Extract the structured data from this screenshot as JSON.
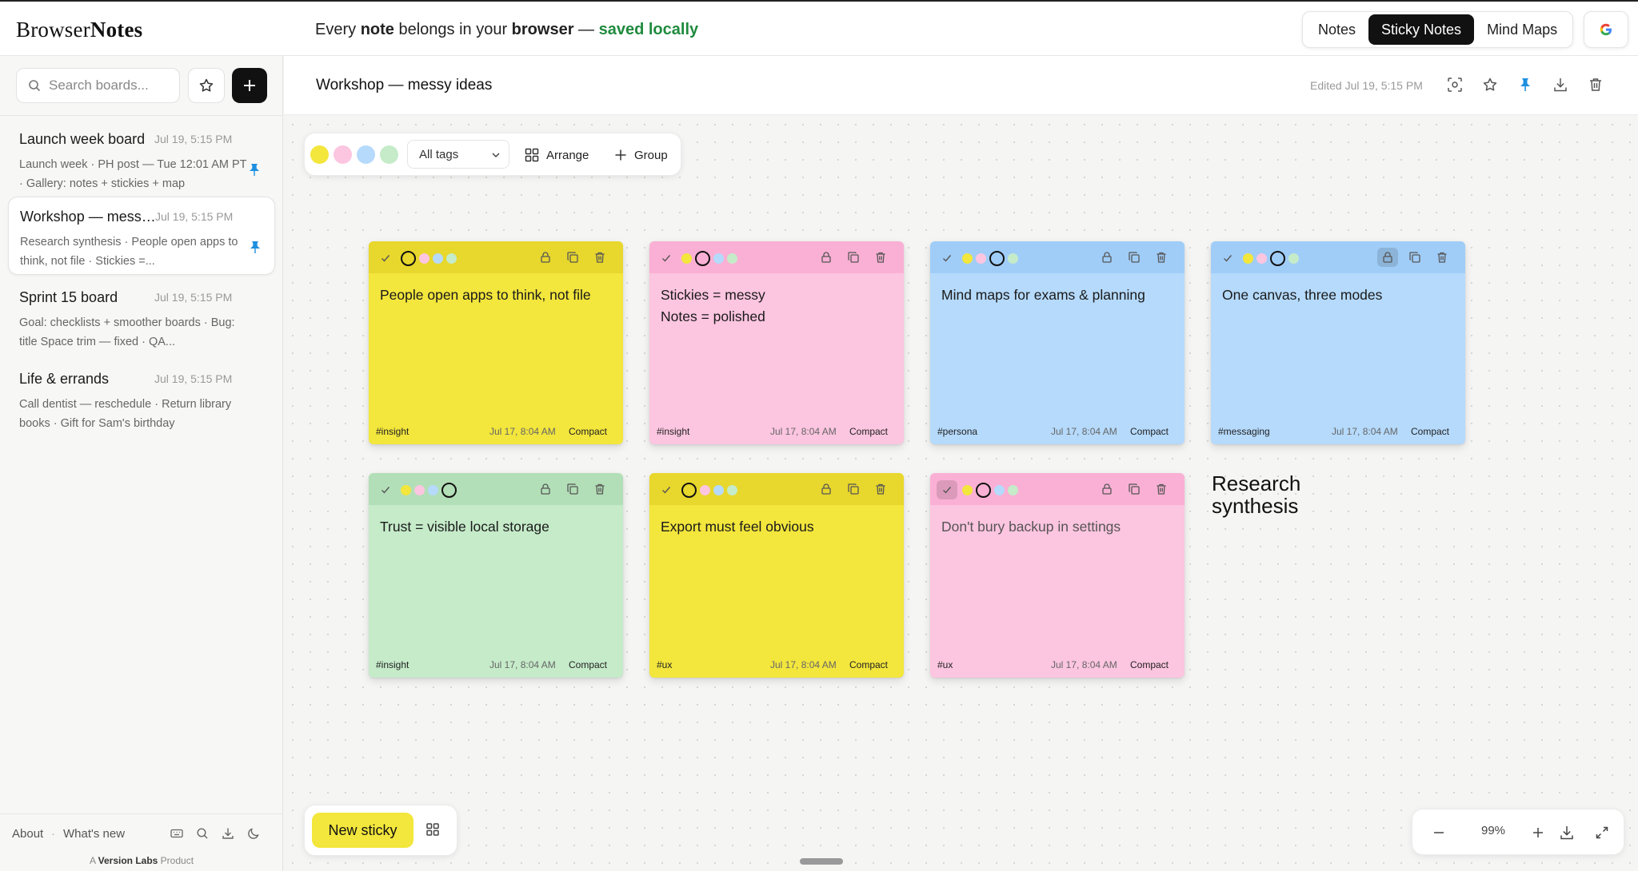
{
  "header": {
    "logo_light": "Browser",
    "logo_bold": "Notes",
    "tagline_1": "Every ",
    "tagline_2": "note",
    "tagline_3": " belongs in your ",
    "tagline_4": "browser",
    "tagline_5": " — ",
    "tagline_6": "saved locally",
    "modes": [
      "Notes",
      "Sticky Notes",
      "Mind Maps"
    ],
    "active_mode": "Sticky Notes",
    "account_icon": "google-icon"
  },
  "sidebar": {
    "search_placeholder": "Search boards...",
    "boards": [
      {
        "title": "Launch week board",
        "date": "Jul 19, 5:15 PM",
        "snippet": "Launch week · PH post — Tue 12:01 AM PT · Gallery: notes + stickies + map",
        "pinned": true,
        "active": false
      },
      {
        "title": "Workshop — messy ideas",
        "date": "Jul 19, 5:15 PM",
        "snippet": "Research synthesis · People open apps to think, not file · Stickies =...",
        "pinned": true,
        "active": true
      },
      {
        "title": "Sprint 15 board",
        "date": "Jul 19, 5:15 PM",
        "snippet": "Goal: checklists + smoother boards · Bug: title Space trim — fixed · QA...",
        "pinned": false,
        "active": false
      },
      {
        "title": "Life & errands",
        "date": "Jul 19, 5:15 PM",
        "snippet": "Call dentist — reschedule · Return library books · Gift for Sam's birthday",
        "pinned": false,
        "active": false
      }
    ],
    "footer": {
      "about": "About",
      "separator": "·",
      "whats_new": "What's new",
      "credit_prefix": "A ",
      "credit_brand": "Version Labs",
      "credit_suffix": " Product"
    }
  },
  "board": {
    "title": "Workshop — messy ideas",
    "edited": "Edited Jul 19, 5:15 PM"
  },
  "toolbar": {
    "swatches": [
      "#f3e63c",
      "#fcc5e0",
      "#b5dafc",
      "#c5ebc9"
    ],
    "tag_filter": "All tags",
    "arrange_label": "Arrange",
    "group_label": "Group"
  },
  "stickies": [
    {
      "text": "People open apps to think, not file",
      "tag": "#insight",
      "date": "Jul 17, 8:04 AM",
      "mode": "Compact",
      "color": "yellow",
      "selected_dot": 0
    },
    {
      "text": "Stickies = messy\nNotes = polished",
      "tag": "#insight",
      "date": "Jul 17, 8:04 AM",
      "mode": "Compact",
      "color": "pink",
      "selected_dot": 1
    },
    {
      "text": "Mind maps for exams & planning",
      "tag": "#persona",
      "date": "Jul 17, 8:04 AM",
      "mode": "Compact",
      "color": "blue",
      "selected_dot": 2
    },
    {
      "text": "One canvas, three modes",
      "tag": "#messaging",
      "date": "Jul 17, 8:04 AM",
      "mode": "Compact",
      "color": "blue",
      "selected_dot": 2,
      "locked": true
    },
    {
      "text": "Trust = visible local storage",
      "tag": "#insight",
      "date": "Jul 17, 8:04 AM",
      "mode": "Compact",
      "color": "green",
      "selected_dot": 3
    },
    {
      "text": "Export must feel obvious",
      "tag": "#ux",
      "date": "Jul 17, 8:04 AM",
      "mode": "Compact",
      "color": "yellow",
      "selected_dot": 0
    },
    {
      "text": "Don't bury backup in settings",
      "tag": "#ux",
      "date": "Jul 17, 8:04 AM",
      "mode": "Compact",
      "color": "pink",
      "selected_dot": 1,
      "done": true
    }
  ],
  "group_label": "Research synthesis",
  "bottom": {
    "new_sticky": "New sticky",
    "zoom": "99%"
  }
}
